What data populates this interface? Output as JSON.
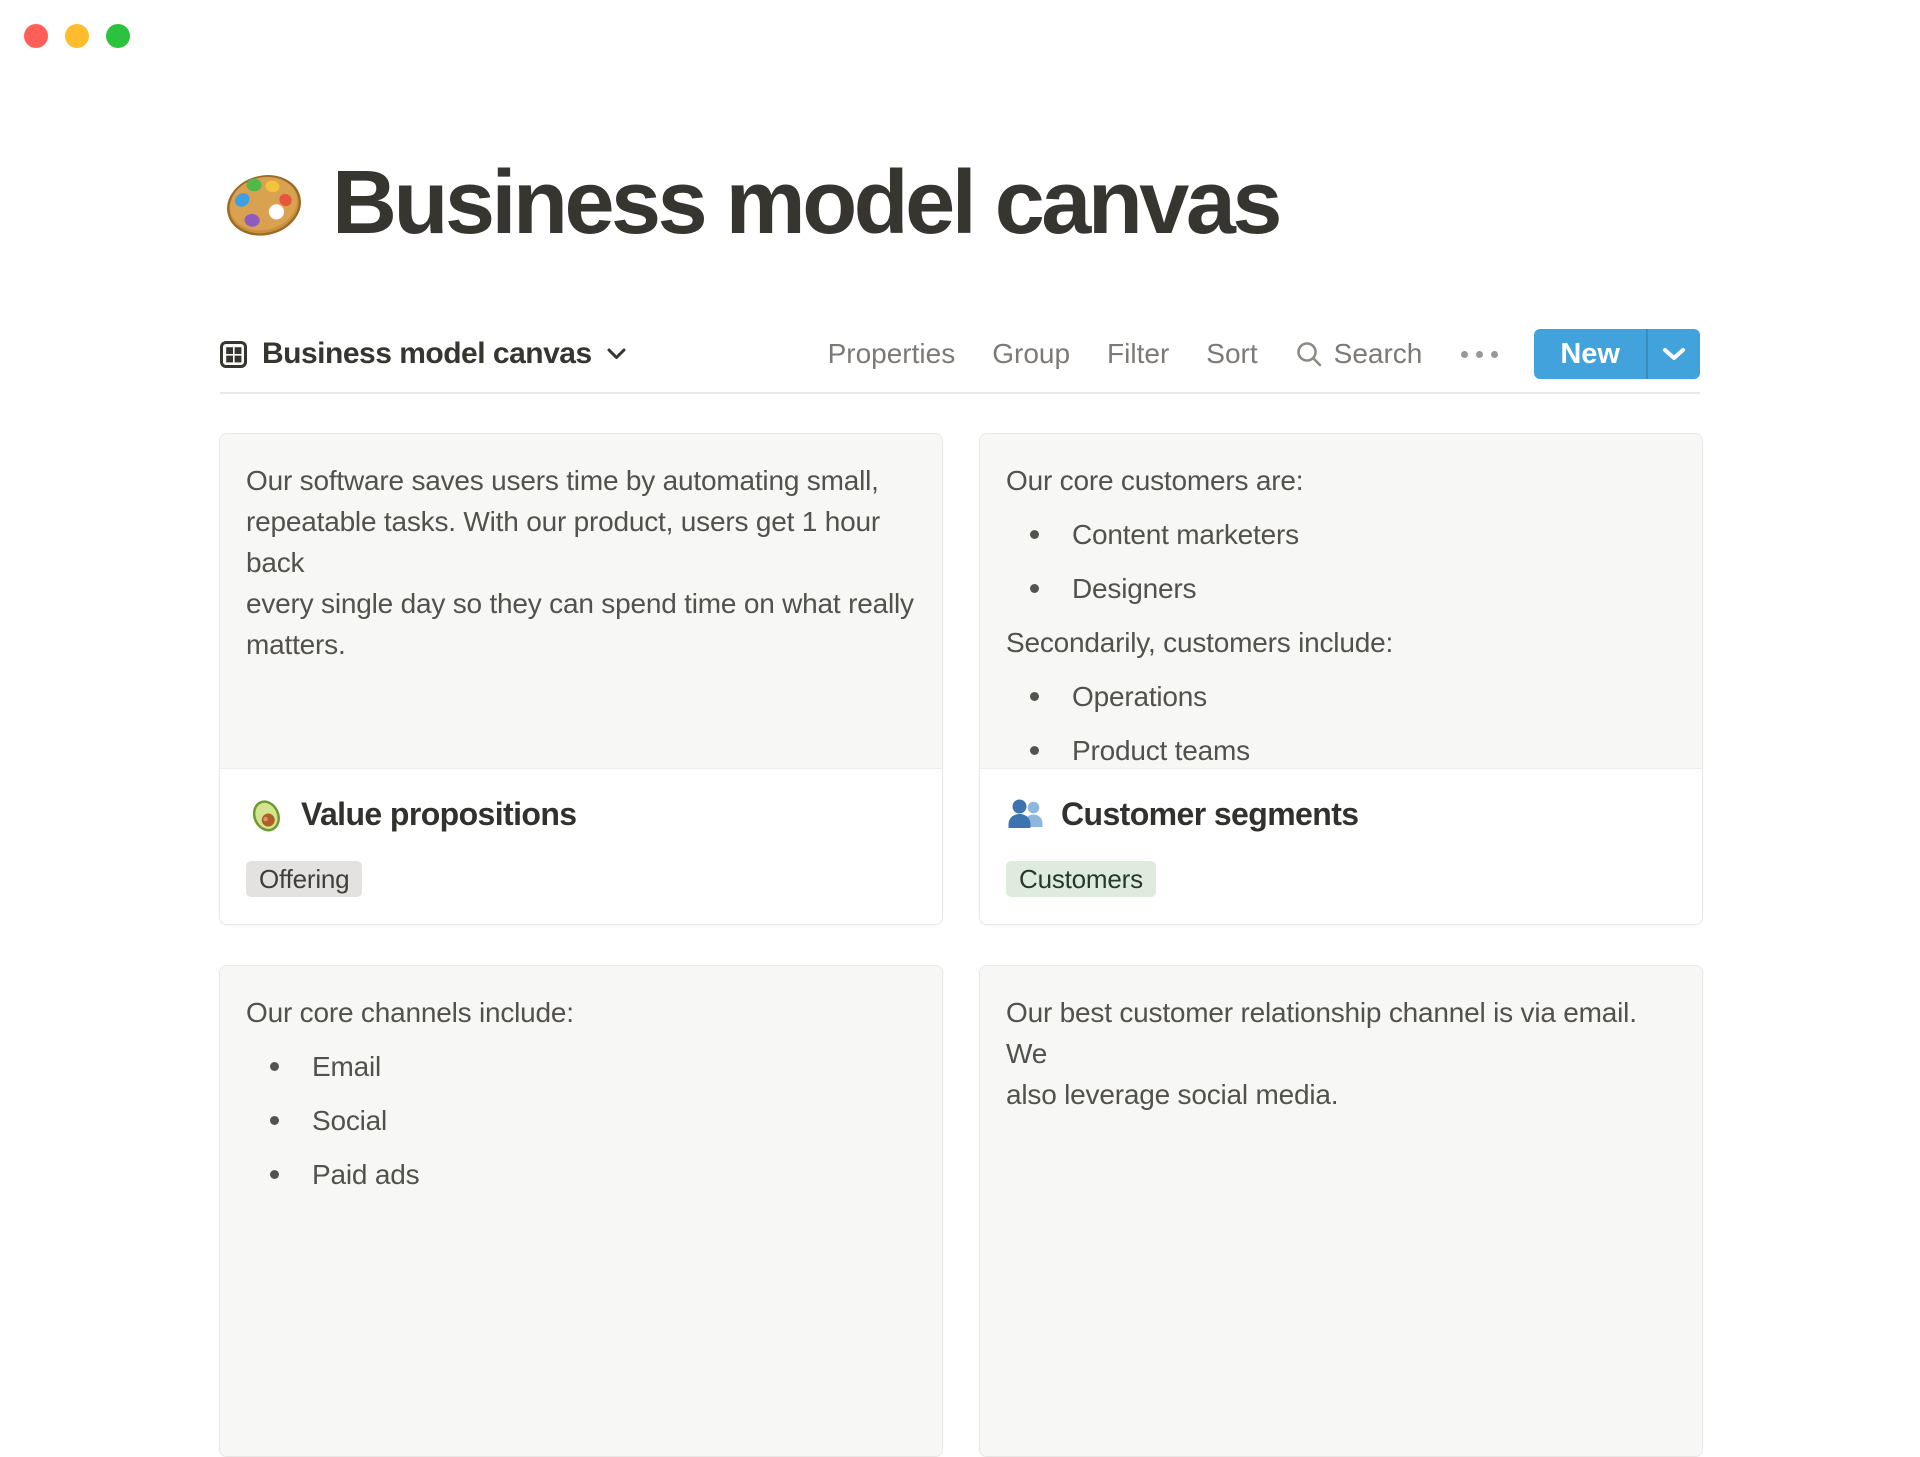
{
  "window": {
    "traffic_lights": [
      {
        "name": "close",
        "color": "#ff5f57"
      },
      {
        "name": "minimize",
        "color": "#febc2e"
      },
      {
        "name": "zoom",
        "color": "#2bc23e"
      }
    ]
  },
  "page": {
    "icon": "palette-emoji",
    "title": "Business model canvas"
  },
  "view_bar": {
    "view": {
      "icon": "gallery-grid",
      "label": "Business model canvas",
      "chevron": "down"
    },
    "actions": [
      {
        "label": "Properties"
      },
      {
        "label": "Group"
      },
      {
        "label": "Filter"
      },
      {
        "label": "Sort"
      },
      {
        "label": "Search",
        "icon": "search"
      }
    ],
    "more_icon": "ellipsis",
    "new_button": {
      "label": "New",
      "chevron": "down",
      "color": "#42a3dc"
    }
  },
  "cards": [
    {
      "preview": {
        "blocks": [
          {
            "type": "paragraph",
            "lines": [
              "Our software saves users time by automating small,",
              "repeatable tasks. With our product, users get 1 hour back",
              "every single day so they can spend time on what really",
              "matters."
            ]
          }
        ]
      },
      "footer": {
        "emoji": "avocado-emoji",
        "title": "Value propositions",
        "tag": {
          "label": "Offering",
          "color": "gray"
        }
      }
    },
    {
      "preview": {
        "blocks": [
          {
            "type": "paragraph",
            "lines": [
              "Our core customers are:"
            ]
          },
          {
            "type": "bullets",
            "items": [
              "Content marketers",
              "Designers"
            ]
          },
          {
            "type": "paragraph",
            "lines": [
              "Secondarily, customers include:"
            ]
          },
          {
            "type": "bullets",
            "items": [
              "Operations",
              "Product teams"
            ]
          }
        ]
      },
      "footer": {
        "emoji": "busts-emoji",
        "title": "Customer segments",
        "tag": {
          "label": "Customers",
          "color": "green"
        }
      }
    },
    {
      "preview": {
        "blocks": [
          {
            "type": "paragraph",
            "lines": [
              "Our core channels include:"
            ]
          },
          {
            "type": "bullets",
            "items": [
              "Email",
              "Social",
              "Paid ads"
            ]
          }
        ]
      },
      "footer": null
    },
    {
      "preview": {
        "blocks": [
          {
            "type": "paragraph",
            "lines": [
              "Our best customer relationship channel is via email. We",
              "also leverage social media."
            ]
          }
        ]
      },
      "footer": null
    }
  ],
  "colors": {
    "accent_blue": "#42a3dc",
    "text_dark": "#37352f",
    "text_muted": "#7d7a75",
    "card_preview_bg": "#f7f7f5",
    "card_border": "#e8e7e5",
    "tag_gray_bg": "#e3e2e0",
    "tag_green_bg": "#dfecdd"
  }
}
